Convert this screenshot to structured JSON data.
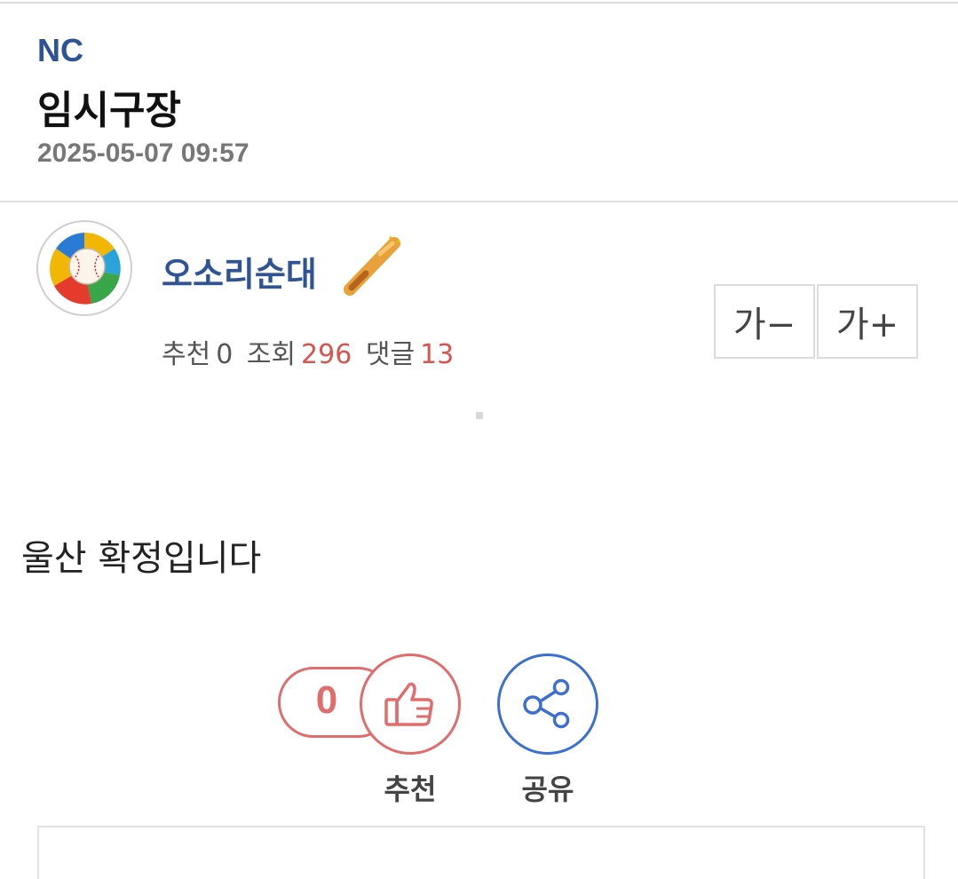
{
  "post": {
    "category": "NC",
    "title": "임시구장",
    "date": "2025-05-07 09:57",
    "author": "오소리순대",
    "stats": {
      "recommend_label": "추천",
      "recommend_count": "0",
      "views_label": "조회",
      "views_count": "296",
      "comments_label": "댓글",
      "comments_count": "13"
    },
    "body": "울산 확정입니다"
  },
  "font_controls": {
    "decrease_label": "가−",
    "increase_label": "가+"
  },
  "actions": {
    "recommend_count": "0",
    "recommend_label": "추천",
    "share_label": "공유"
  },
  "icons": {
    "avatar": "wbc-baseball-logo",
    "badge": "baseball-bat-icon",
    "recommend": "thumbs-up-icon",
    "share": "share-icon"
  },
  "colors": {
    "accent_blue": "#2f5496",
    "count_red": "#d9534f",
    "recommend_red": "#e06c6c",
    "share_blue": "#3b6fd1"
  }
}
